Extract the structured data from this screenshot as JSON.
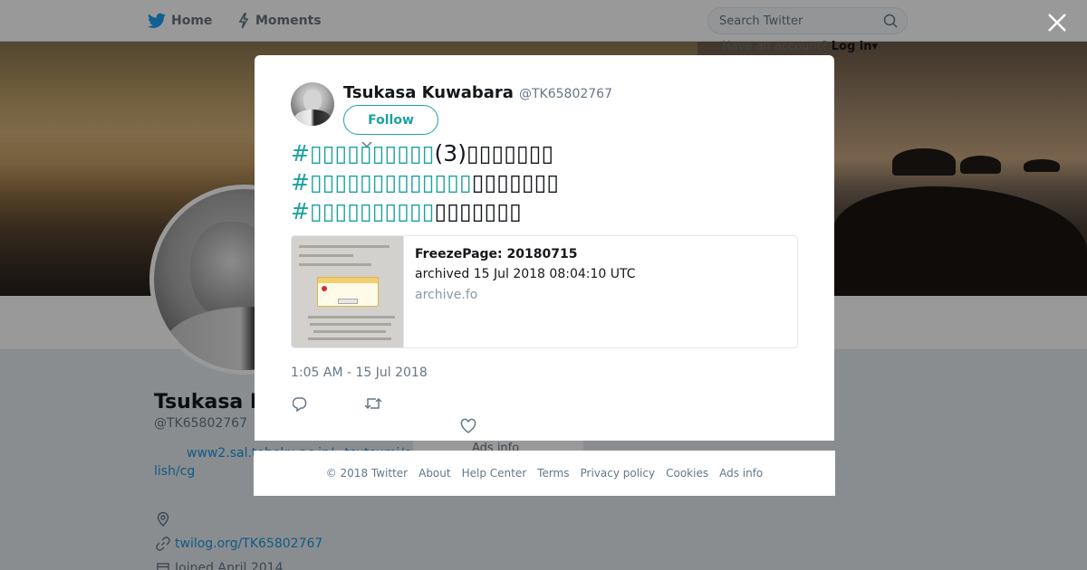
{
  "nav": {
    "home_label": "Home",
    "moments_label": "Moments",
    "search_placeholder": "Search Twitter",
    "have_account_text": "Have an account?",
    "login_label": "Log in"
  },
  "profile": {
    "name_visible": "Tsukasa K",
    "handle": "@TK65802767",
    "bio_link": "www2.sal.tohoku.ac.jp/~tsutsumi/eng lish/cg",
    "website": "twilog.org/TK65802767",
    "joined": "Joined April 2014",
    "ads_info": "Ads info"
  },
  "tweet": {
    "author_name": "Tsukasa Kuwabara",
    "author_handle": "@TK65802767",
    "follow_label": "Follow",
    "lines": [
      {
        "hashtag": "#▯▯▯▯▯▯▯▯▯▯",
        "rest": "(3)▯▯▯▯▯▯▯"
      },
      {
        "hashtag": "#▯▯▯▯▯▯▯▯▯▯▯▯▯",
        "rest": "▯▯▯▯▯▯▯"
      },
      {
        "hashtag": "#▯▯▯▯▯▯▯▯▯▯",
        "rest": "▯▯▯▯▯▯▯"
      }
    ],
    "card": {
      "title": "FreezePage: 20180715",
      "description": "archived 15 Jul 2018 08:04:10 UTC",
      "domain": "archive.fo"
    },
    "timestamp": "1:05 AM - 15 Jul 2018"
  },
  "footer": {
    "copyright": "© 2018 Twitter",
    "links": [
      "About",
      "Help Center",
      "Terms",
      "Privacy policy",
      "Cookies",
      "Ads info"
    ]
  },
  "colors": {
    "accent": "#1da1a0",
    "link": "#1b95e0",
    "text_secondary": "#657786",
    "overlay": "rgba(0,0,0,0.4)"
  },
  "icons": [
    "twitter-bird-icon",
    "lightning-icon",
    "search-icon",
    "close-icon",
    "caret-down-icon",
    "reply-icon",
    "retweet-icon",
    "heart-icon",
    "location-icon",
    "link-icon",
    "calendar-icon"
  ]
}
